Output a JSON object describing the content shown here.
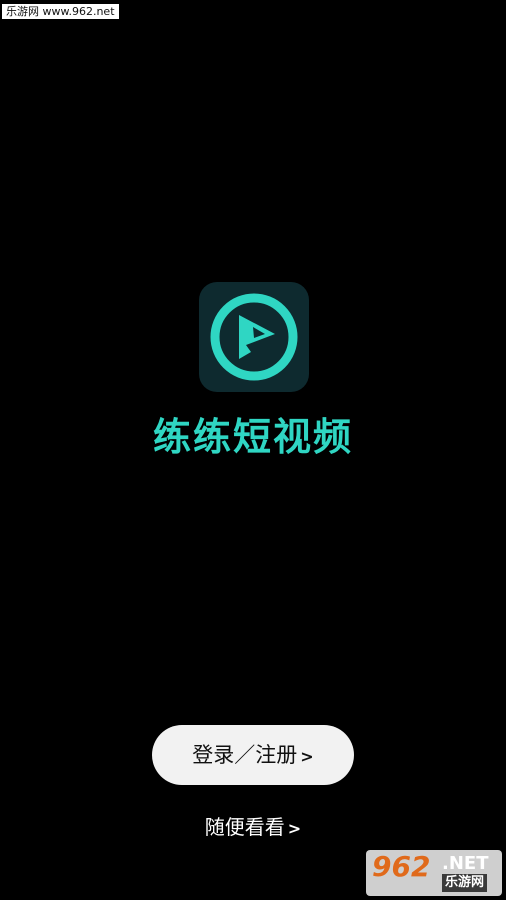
{
  "watermark_top": "乐游网 www.962.net",
  "app": {
    "icon": "play-bolt-logo-icon",
    "name": "练练短视频"
  },
  "actions": {
    "login_label": "登录／注册",
    "login_chevron": ">",
    "browse_label": "随便看看",
    "browse_chevron": ">"
  },
  "watermark_bottom": {
    "number": "962",
    "net": ".NET",
    "site": "乐游网"
  },
  "colors": {
    "background": "#000000",
    "accent": "#2fd6c3",
    "icon_bg": "#0e2a2f",
    "button_bg": "#f2f2f2"
  }
}
